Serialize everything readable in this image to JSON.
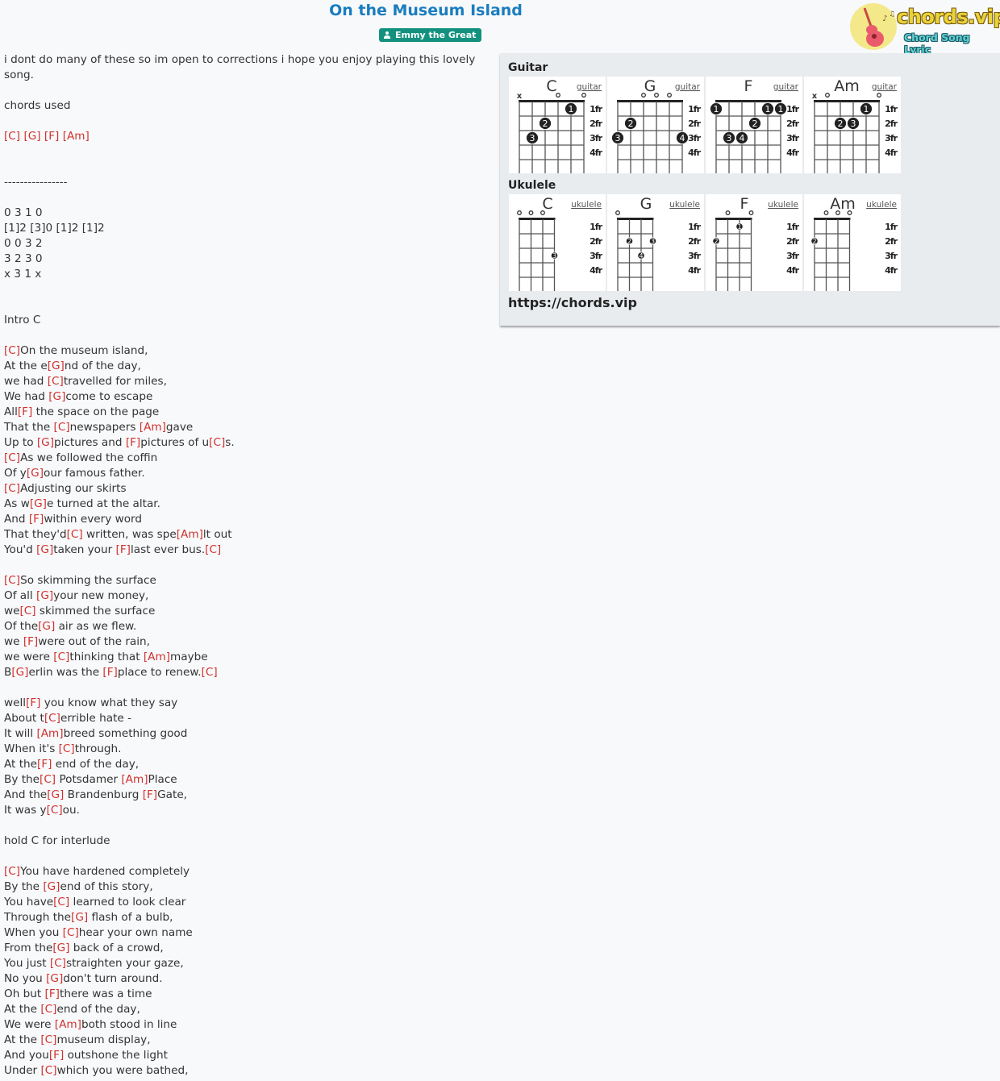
{
  "header": {
    "title": "On the Museum Island",
    "artist": "Emmy the Great",
    "artist_icon": "user-icon"
  },
  "logo": {
    "brand": "chords.vip",
    "tagline": "Chord Song Lyric",
    "icon": "guitar-icon"
  },
  "lyrics": [
    "i dont do many of these so im open to corrections i hope you enjoy playing this lovely",
    "song.",
    "",
    "chords used",
    "",
    "[C] [G] [F] [Am]",
    "",
    "",
    "----------------",
    "",
    "0 3 1 0",
    "\\[1]2 \\[3]0 \\[1]2 \\[1]2",
    "0 0 3 2",
    "3 2 3 0",
    "x 3 1 x",
    "",
    "",
    "Intro C",
    "",
    "[C]On the museum island,",
    "At the e[G]nd of the day,",
    "we had [C]travelled for miles,",
    "We had [G]come to escape",
    "All[F] the space on the page",
    "That the [C]newspapers [Am]gave",
    "Up to [G]pictures and [F]pictures of u[C]s.",
    "[C]As we followed the coffin",
    "Of y[G]our famous father.",
    "[C]Adjusting our skirts",
    "As w[G]e turned at the altar.",
    "And [F]within every word",
    "That they'd[C] written, was spe[Am]lt out",
    "You'd [G]taken your [F]last ever bus.[C]",
    "",
    "[C]So skimming the surface",
    "Of all [G]your new money,",
    "we[C] skimmed the surface",
    "Of the[G] air as we flew.",
    "we [F]were out of the rain,",
    "we were [C]thinking that [Am]maybe",
    "B[G]erlin was the [F]place to renew.[C]",
    "",
    "well[F] you know what they say",
    "About t[C]errible hate -",
    "It will [Am]breed something good",
    "When it's [C]through.",
    "At the[F] end of the day,",
    "By the[C] Potsdamer [Am]Place",
    "And the[G] Brandenburg [F]Gate,",
    "It was y[C]ou.",
    "",
    "hold C for interlude",
    "",
    "[C]You have hardened completely",
    "By the [G]end of this story,",
    "You have[C] learned to look clear",
    "Through the[G] flash of a bulb,",
    "When you [C]hear your own name",
    "From the[G] back of a crowd,",
    "You just [C]straighten your gaze,",
    "No you [G]don't turn around.",
    "Oh but [F]there was a time",
    "At the [C]end of the day,",
    "We were [Am]both stood in line",
    "At the [C]museum display,",
    "And you[F] outshone the light",
    "Under [C]which you were bathed,"
  ],
  "chord_panel": {
    "guitar_heading": "Guitar",
    "ukulele_heading": "Ukulele",
    "site_url": "https://chords.vip",
    "fret_labels": [
      "1fr",
      "2fr",
      "3fr",
      "4fr"
    ],
    "guitar": [
      {
        "name": "C",
        "link": "guitar",
        "strings": 6,
        "open": [
          "x",
          null,
          null,
          "o",
          null,
          "o"
        ],
        "dots": [
          {
            "s": 4,
            "f": 1,
            "n": "1"
          },
          {
            "s": 2,
            "f": 2,
            "n": "2"
          },
          {
            "s": 1,
            "f": 3,
            "n": "3"
          }
        ],
        "barre": null
      },
      {
        "name": "G",
        "link": "guitar",
        "strings": 6,
        "open": [
          null,
          null,
          "o",
          "o",
          "o",
          null
        ],
        "dots": [
          {
            "s": 1,
            "f": 2,
            "n": "2"
          },
          {
            "s": 0,
            "f": 3,
            "n": "3"
          },
          {
            "s": 5,
            "f": 3,
            "n": "4"
          }
        ],
        "barre": null
      },
      {
        "name": "F",
        "link": "guitar",
        "strings": 6,
        "open": [
          null,
          null,
          null,
          null,
          null,
          null
        ],
        "dots": [
          {
            "s": 0,
            "f": 1,
            "n": "1"
          },
          {
            "s": 4,
            "f": 1,
            "n": "1"
          },
          {
            "s": 5,
            "f": 1,
            "n": "1"
          },
          {
            "s": 3,
            "f": 2,
            "n": "2"
          },
          {
            "s": 1,
            "f": 3,
            "n": "3"
          },
          {
            "s": 2,
            "f": 3,
            "n": "4"
          }
        ],
        "barre": 1
      },
      {
        "name": "Am",
        "link": "guitar",
        "strings": 6,
        "open": [
          "x",
          "o",
          null,
          null,
          null,
          "o"
        ],
        "dots": [
          {
            "s": 4,
            "f": 1,
            "n": "1"
          },
          {
            "s": 2,
            "f": 2,
            "n": "2"
          },
          {
            "s": 3,
            "f": 2,
            "n": "3"
          }
        ],
        "barre": null
      }
    ],
    "ukulele": [
      {
        "name": "C",
        "link": "ukulele",
        "strings": 4,
        "open": [
          "o",
          "o",
          "o",
          null
        ],
        "dots": [
          {
            "s": 3,
            "f": 3,
            "n": "3"
          }
        ],
        "barre": null
      },
      {
        "name": "G",
        "link": "ukulele",
        "strings": 4,
        "open": [
          "o",
          null,
          null,
          null
        ],
        "dots": [
          {
            "s": 1,
            "f": 2,
            "n": "2"
          },
          {
            "s": 3,
            "f": 2,
            "n": "3"
          },
          {
            "s": 2,
            "f": 3,
            "n": "4"
          }
        ],
        "barre": null
      },
      {
        "name": "F",
        "link": "ukulele",
        "strings": 4,
        "open": [
          null,
          "o",
          null,
          "o"
        ],
        "dots": [
          {
            "s": 2,
            "f": 1,
            "n": "1"
          },
          {
            "s": 0,
            "f": 2,
            "n": "2"
          }
        ],
        "barre": null
      },
      {
        "name": "Am",
        "link": "ukulele",
        "strings": 4,
        "open": [
          null,
          "o",
          "o",
          "o"
        ],
        "dots": [
          {
            "s": 0,
            "f": 2,
            "n": "2"
          }
        ],
        "barre": null
      }
    ]
  },
  "colors": {
    "title": "#1a7dbf",
    "artist_badge": "#13917e",
    "chord_text": "#d0312d",
    "panel_bg": "#e9ecef"
  }
}
